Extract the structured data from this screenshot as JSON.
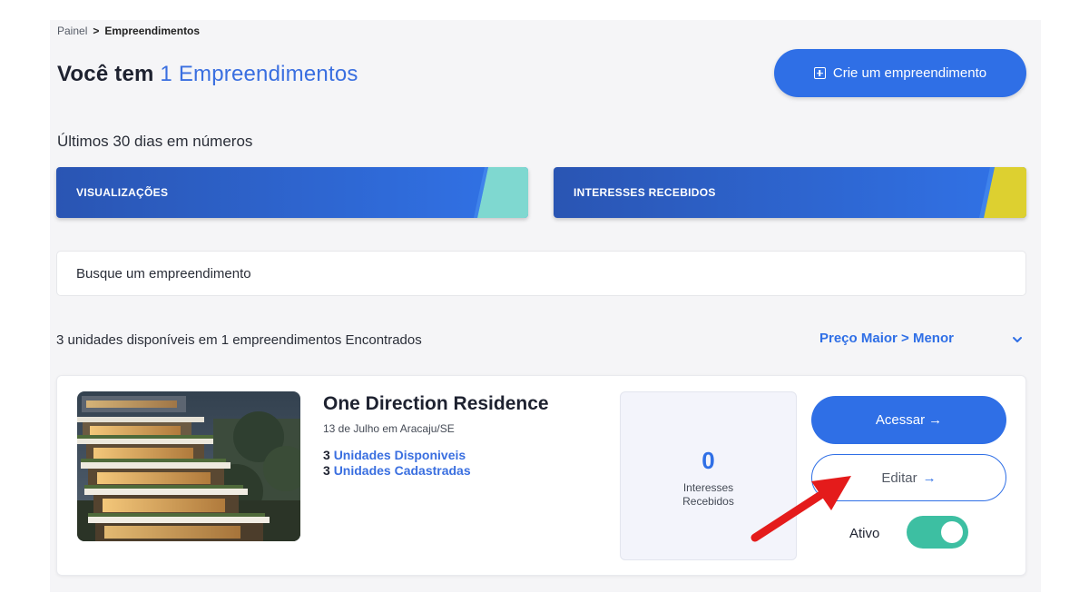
{
  "breadcrumb": {
    "root": "Painel",
    "separator": ">",
    "current": "Empreendimentos"
  },
  "header": {
    "title_prefix": "Você tem",
    "title_count": "1 Empreendimentos",
    "create_button": "Crie um empreendimento",
    "create_icon": "plus-square-icon"
  },
  "stats": {
    "title": "Últimos 30 dias em números",
    "cards": [
      {
        "label": "VISUALIZAÇÕES",
        "accent": "#7fd8d0"
      },
      {
        "label": "INTERESSES RECEBIDOS",
        "accent": "#ddd030"
      }
    ]
  },
  "search": {
    "placeholder": "Busque um empreendimento"
  },
  "results": {
    "summary": "3 unidades disponíveis em 1 empreendimentos Encontrados",
    "sort_label": "Preço Maior > Menor"
  },
  "listing": {
    "title": "One Direction Residence",
    "date_location": "13 de Julho em Aracaju/SE",
    "units_available_count": "3",
    "units_available_label": "Unidades Disponiveis",
    "units_registered_count": "3",
    "units_registered_label": "Unidades Cadastradas",
    "interests_count": "0",
    "interests_label_line1": "Interesses",
    "interests_label_line2": "Recebidos",
    "access_button": "Acessar",
    "edit_button": "Editar",
    "active_label": "Ativo",
    "active": true
  },
  "colors": {
    "primary": "#2f6fe6",
    "toggle_on": "#3dbfa2",
    "annotation_arrow": "#e41b1b"
  }
}
